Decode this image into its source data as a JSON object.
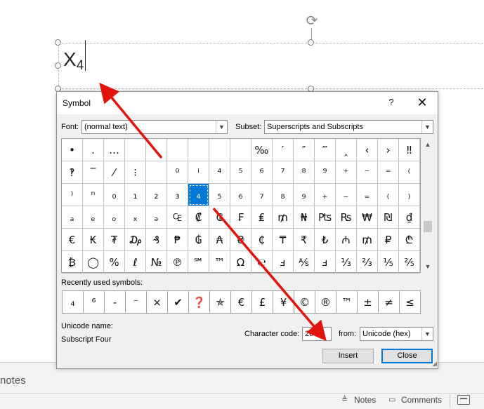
{
  "slide": {
    "text_base": "X",
    "text_sub": "4"
  },
  "notes": {
    "placeholder": "notes"
  },
  "status_bar": {
    "notes_label": "Notes",
    "comments_label": "Comments"
  },
  "dialog": {
    "title": "Symbol",
    "help": "?",
    "close": "✕",
    "font_label": "Font:",
    "font_value": "(normal text)",
    "subset_label": "Subset:",
    "subset_value": "Superscripts and Subscripts",
    "recent_label": "Recently used symbols:",
    "unicode_name_label": "Unicode name:",
    "unicode_name_value": "Subscript Four",
    "char_code_label": "Character code:",
    "char_code_value": "2084",
    "from_label": "from:",
    "from_value": "Unicode (hex)",
    "insert_label": "Insert",
    "close_label": "Close",
    "selected_symbol": "4",
    "symbol_rows": [
      [
        "•",
        ".",
        "…",
        "",
        "",
        "",
        "",
        "",
        "",
        "‰",
        "′",
        "″",
        "‴",
        "‸",
        "‹",
        "›",
        "‼"
      ],
      [
        "‽",
        "‾",
        "⁄",
        "⁝",
        "",
        "⁰",
        "ⁱ",
        "⁴",
        "⁵",
        "⁶",
        "⁷",
        "⁸",
        "⁹",
        "⁺",
        "⁻",
        "⁼",
        "⁽"
      ],
      [
        "⁾",
        "ⁿ",
        "₀",
        "₁",
        "₂",
        "₃",
        "₄",
        "₅",
        "₆",
        "₇",
        "₈",
        "₉",
        "₊",
        "₋",
        "₌",
        "₍",
        "₎"
      ],
      [
        "ₐ",
        "ₑ",
        "ₒ",
        "ₓ",
        "ₔ",
        "₠",
        "₡",
        "₢",
        "₣",
        "₤",
        "₥",
        "₦",
        "₧",
        "₨",
        "₩",
        "₪",
        "₫"
      ],
      [
        "€",
        "₭",
        "₮",
        "₯",
        "₰",
        "₱",
        "₲",
        "₳",
        "₴",
        "₵",
        "₸",
        "₹",
        "₺",
        "₼",
        "₥",
        "₽",
        "₾"
      ],
      [
        "₿",
        "◯",
        "%",
        "ℓ",
        "№",
        "℗",
        "℠",
        "™",
        "Ω",
        "℮",
        "ⅎ",
        "⅍",
        "ⅎ",
        "⅓",
        "⅔",
        "⅕",
        "⅖"
      ]
    ],
    "recent_symbols": [
      "₄",
      "⁶",
      "-",
      "⁻",
      "×",
      "✔",
      "❓",
      "✯",
      "€",
      "£",
      "¥",
      "©",
      "®",
      "™",
      "±",
      "≠",
      "≤"
    ]
  },
  "colors": {
    "selection": "#0078d7",
    "arrow": "#e3120b"
  }
}
